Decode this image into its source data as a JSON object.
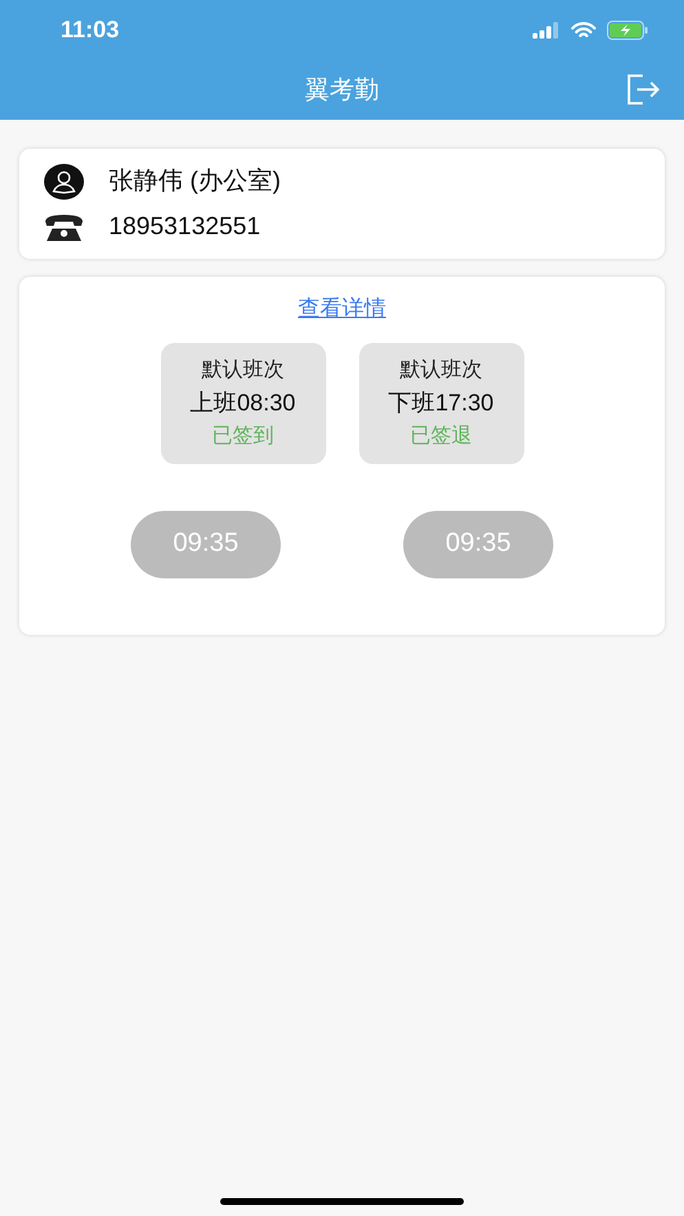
{
  "status_bar": {
    "time": "11:03"
  },
  "nav": {
    "title": "翼考勤"
  },
  "profile": {
    "name": "张静伟 (办公室)",
    "phone": "18953132551"
  },
  "attendance": {
    "details_link": "查看详情",
    "shifts": [
      {
        "label": "默认班次",
        "time": "上班08:30",
        "status": "已签到"
      },
      {
        "label": "默认班次",
        "time": "下班17:30",
        "status": "已签退"
      }
    ],
    "clock_buttons": [
      "09:35",
      "09:35"
    ]
  }
}
